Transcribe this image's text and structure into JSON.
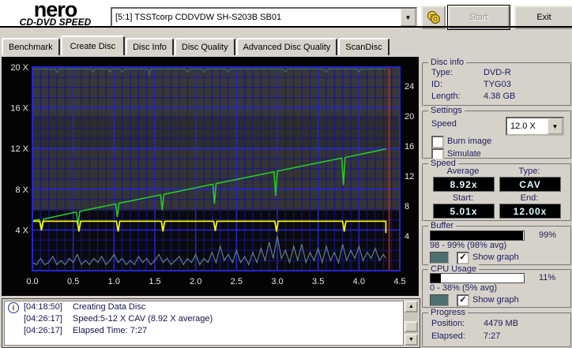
{
  "header": {
    "logo_line1": "nero",
    "logo_line2": "CD-DVD SPEED",
    "drive_select": "[5:1]   TSSTcorp CDDVDW SH-S203B SB01",
    "burn_icon": "burn-discs-icon",
    "start_label": "Start",
    "exit_label": "Exit"
  },
  "tabs": [
    {
      "label": "Benchmark",
      "active": false
    },
    {
      "label": "Create Disc",
      "active": true
    },
    {
      "label": "Disc Info",
      "active": false
    },
    {
      "label": "Disc Quality",
      "active": false
    },
    {
      "label": "Advanced Disc Quality",
      "active": false
    },
    {
      "label": "ScanDisc",
      "active": false
    }
  ],
  "chart_data": {
    "type": "line",
    "x_range": [
      0,
      4.5
    ],
    "x_ticks": [
      "0.0",
      "0.5",
      "1.0",
      "1.5",
      "2.0",
      "2.5",
      "3.0",
      "3.5",
      "4.0",
      "4.5"
    ],
    "x_minor_step": 0.1,
    "x_major_step": 0.5,
    "y_left": {
      "range": [
        0,
        20
      ],
      "minor_step": 1,
      "major_step": 4,
      "ticks": [
        "4 X",
        "8 X",
        "12 X",
        "16 X",
        "20 X"
      ],
      "tick_values": [
        4,
        8,
        12,
        16,
        20
      ]
    },
    "y_right": {
      "ticks": [
        "4",
        "8",
        "12",
        "16",
        "20",
        "24"
      ]
    },
    "grid": {
      "minor_color": "#15158e",
      "major_color": "#2525cd",
      "border_color": "#2525cd"
    },
    "bands": [
      {
        "from": 20.0,
        "to": 15.2,
        "color": "#373737"
      },
      {
        "from": 15.2,
        "to": 12.2,
        "color": "#2d2d2d"
      },
      {
        "from": 12.2,
        "to": 5.9,
        "color": "#343434"
      },
      {
        "from": 5.9,
        "to": 0.0,
        "color": "#0a0a0c"
      }
    ],
    "position_marker": {
      "x": 4.37,
      "color": "#cc2222"
    },
    "series": [
      {
        "name": "write-speed",
        "color": "#28c828",
        "width": 1.6,
        "unit": "x",
        "points": [
          [
            0,
            4.9
          ],
          [
            0.08,
            5.03
          ],
          [
            0.1,
            4.55
          ],
          [
            0.12,
            4.25
          ],
          [
            0.14,
            5.08
          ],
          [
            0.54,
            5.77
          ],
          [
            0.56,
            4.55
          ],
          [
            0.58,
            5.83
          ],
          [
            1.02,
            6.56
          ],
          [
            1.04,
            5.25
          ],
          [
            1.06,
            6.62
          ],
          [
            1.57,
            7.45
          ],
          [
            1.59,
            5.95
          ],
          [
            1.61,
            7.5
          ],
          [
            2.21,
            8.49
          ],
          [
            2.23,
            6.6
          ],
          [
            2.25,
            8.55
          ],
          [
            2.96,
            9.71
          ],
          [
            2.98,
            7.35
          ],
          [
            3.0,
            9.78
          ],
          [
            3.79,
            11.06
          ],
          [
            3.81,
            8.4
          ],
          [
            3.83,
            11.12
          ],
          [
            4.33,
            11.95
          ]
        ]
      },
      {
        "name": "rotation-speed",
        "color": "#f5f500",
        "width": 1.8,
        "unit": "x",
        "points": [
          [
            0,
            4.85
          ],
          [
            0.09,
            4.85
          ],
          [
            0.11,
            3.95
          ],
          [
            0.13,
            4.85
          ],
          [
            0.55,
            4.85
          ],
          [
            0.57,
            3.85
          ],
          [
            0.59,
            4.85
          ],
          [
            1.03,
            4.85
          ],
          [
            1.05,
            3.85
          ],
          [
            1.07,
            4.85
          ],
          [
            1.58,
            4.85
          ],
          [
            1.6,
            3.85
          ],
          [
            1.62,
            4.85
          ],
          [
            2.22,
            4.85
          ],
          [
            2.24,
            3.9
          ],
          [
            2.26,
            4.85
          ],
          [
            2.97,
            4.85
          ],
          [
            2.99,
            3.85
          ],
          [
            3.01,
            4.85
          ],
          [
            3.8,
            4.85
          ],
          [
            3.82,
            3.85
          ],
          [
            3.84,
            4.85
          ],
          [
            4.31,
            4.85
          ],
          [
            4.33,
            4.85
          ],
          [
            4.33,
            3.7
          ]
        ]
      },
      {
        "name": "buffer-level",
        "color": "#3c6060",
        "width": 1.4,
        "unit": "%",
        "points": [
          [
            0,
            99
          ],
          [
            0.28,
            99
          ],
          [
            0.3,
            97.5
          ],
          [
            0.32,
            99
          ],
          [
            0.72,
            99
          ],
          [
            0.74,
            97.5
          ],
          [
            0.76,
            99
          ],
          [
            0.93,
            99
          ],
          [
            0.95,
            97.5
          ],
          [
            0.97,
            99
          ],
          [
            1.08,
            99
          ],
          [
            1.1,
            97.5
          ],
          [
            1.12,
            99
          ],
          [
            1.41,
            99
          ],
          [
            1.43,
            96
          ],
          [
            1.45,
            99
          ],
          [
            1.88,
            99
          ],
          [
            1.9,
            97.5
          ],
          [
            1.92,
            99
          ],
          [
            2.08,
            99
          ],
          [
            2.1,
            97.5
          ],
          [
            2.12,
            99
          ],
          [
            2.38,
            99
          ],
          [
            2.4,
            97.5
          ],
          [
            2.42,
            99
          ],
          [
            3.08,
            99
          ],
          [
            3.1,
            97.5
          ],
          [
            3.12,
            99
          ],
          [
            3.58,
            99
          ],
          [
            3.6,
            97.5
          ],
          [
            3.62,
            99
          ],
          [
            3.98,
            99
          ],
          [
            4.0,
            97.5
          ],
          [
            4.02,
            99
          ],
          [
            4.33,
            99
          ]
        ]
      },
      {
        "name": "cpu-usage",
        "color": "#5d8181",
        "width": 1.2,
        "unit": "%",
        "points": [
          [
            0,
            4
          ],
          [
            0.05,
            3
          ],
          [
            0.1,
            6
          ],
          [
            0.15,
            3
          ],
          [
            0.2,
            4
          ],
          [
            0.25,
            7
          ],
          [
            0.3,
            3
          ],
          [
            0.35,
            5
          ],
          [
            0.4,
            3
          ],
          [
            0.45,
            6
          ],
          [
            0.5,
            4
          ],
          [
            0.55,
            8
          ],
          [
            0.6,
            3
          ],
          [
            0.65,
            5
          ],
          [
            0.7,
            3
          ],
          [
            0.75,
            6
          ],
          [
            0.8,
            4
          ],
          [
            0.85,
            7
          ],
          [
            0.9,
            3
          ],
          [
            0.95,
            5
          ],
          [
            1,
            8
          ],
          [
            1.05,
            4
          ],
          [
            1.1,
            6
          ],
          [
            1.15,
            3
          ],
          [
            1.2,
            5
          ],
          [
            1.25,
            3
          ],
          [
            1.3,
            7
          ],
          [
            1.35,
            4
          ],
          [
            1.4,
            6
          ],
          [
            1.45,
            3
          ],
          [
            1.5,
            5
          ],
          [
            1.55,
            8
          ],
          [
            1.6,
            4
          ],
          [
            1.65,
            6
          ],
          [
            1.7,
            3
          ],
          [
            1.75,
            5
          ],
          [
            1.8,
            7
          ],
          [
            1.85,
            3
          ],
          [
            1.9,
            6
          ],
          [
            1.95,
            4
          ],
          [
            2,
            8
          ],
          [
            2.05,
            3
          ],
          [
            2.1,
            6
          ],
          [
            2.15,
            4
          ],
          [
            2.2,
            9
          ],
          [
            2.25,
            4
          ],
          [
            2.3,
            12
          ],
          [
            2.35,
            5
          ],
          [
            2.4,
            8
          ],
          [
            2.45,
            4
          ],
          [
            2.5,
            10
          ],
          [
            2.55,
            4
          ],
          [
            2.6,
            7
          ],
          [
            2.65,
            3
          ],
          [
            2.7,
            9
          ],
          [
            2.75,
            4
          ],
          [
            2.8,
            11
          ],
          [
            2.85,
            5
          ],
          [
            2.9,
            14
          ],
          [
            2.95,
            6
          ],
          [
            3,
            17
          ],
          [
            3.05,
            6
          ],
          [
            3.1,
            10
          ],
          [
            3.15,
            4
          ],
          [
            3.2,
            12
          ],
          [
            3.25,
            5
          ],
          [
            3.3,
            13
          ],
          [
            3.35,
            4
          ],
          [
            3.4,
            9
          ],
          [
            3.45,
            5
          ],
          [
            3.5,
            11
          ],
          [
            3.55,
            4
          ],
          [
            3.6,
            12
          ],
          [
            3.65,
            5
          ],
          [
            3.7,
            9
          ],
          [
            3.75,
            4
          ],
          [
            3.8,
            13
          ],
          [
            3.85,
            5
          ],
          [
            3.9,
            10
          ],
          [
            3.95,
            6
          ],
          [
            4,
            12
          ],
          [
            4.05,
            5
          ],
          [
            4.1,
            9
          ],
          [
            4.15,
            6
          ],
          [
            4.2,
            11
          ],
          [
            4.25,
            5
          ],
          [
            4.3,
            8
          ],
          [
            4.33,
            6
          ]
        ]
      }
    ]
  },
  "disc_info": {
    "title": "Disc info",
    "type_label": "Type:",
    "type_value": "DVD-R",
    "id_label": "ID:",
    "id_value": "TYG03",
    "length_label": "Length:",
    "length_value": "4.38 GB"
  },
  "settings": {
    "title": "Settings",
    "speed_label": "Speed",
    "speed_value": "12.0 X",
    "burn_image_label": "Burn image",
    "burn_image_checked": false,
    "simulate_label": "Simulate",
    "simulate_checked": false
  },
  "speed": {
    "title": "Speed",
    "average_label": "Average",
    "average_value": "8.92x",
    "type_label": "Type:",
    "type_value": "CAV",
    "start_label": "Start:",
    "start_value": "5.01x",
    "end_label": "End:",
    "end_value": "12.00x"
  },
  "buffer": {
    "title": "Buffer",
    "percent": 99,
    "percent_label": "99%",
    "range_text": "98 - 99% (98% avg)",
    "show_graph_label": "Show graph",
    "show_graph_checked": true,
    "graph_color": "#4d6f6f"
  },
  "cpu": {
    "title": "CPU Usage",
    "percent": 11,
    "percent_label": "11%",
    "range_text": "0 - 38% (5% avg)",
    "show_graph_label": "Show graph",
    "show_graph_checked": true,
    "graph_color": "#4d6f6f"
  },
  "progress": {
    "title": "Progress",
    "position_label": "Position:",
    "position_value": "4479 MB",
    "elapsed_label": "Elapsed:",
    "elapsed_value": "7:27"
  },
  "log": {
    "entries": [
      {
        "icon": true,
        "time": "[04:18:50]",
        "text": "Creating Data Disc"
      },
      {
        "icon": false,
        "time": "[04:26:17]",
        "text": "Speed:5-12 X CAV (8.92 X average)"
      },
      {
        "icon": false,
        "time": "[04:26:17]",
        "text": "Elapsed Time:  7:27"
      }
    ]
  }
}
